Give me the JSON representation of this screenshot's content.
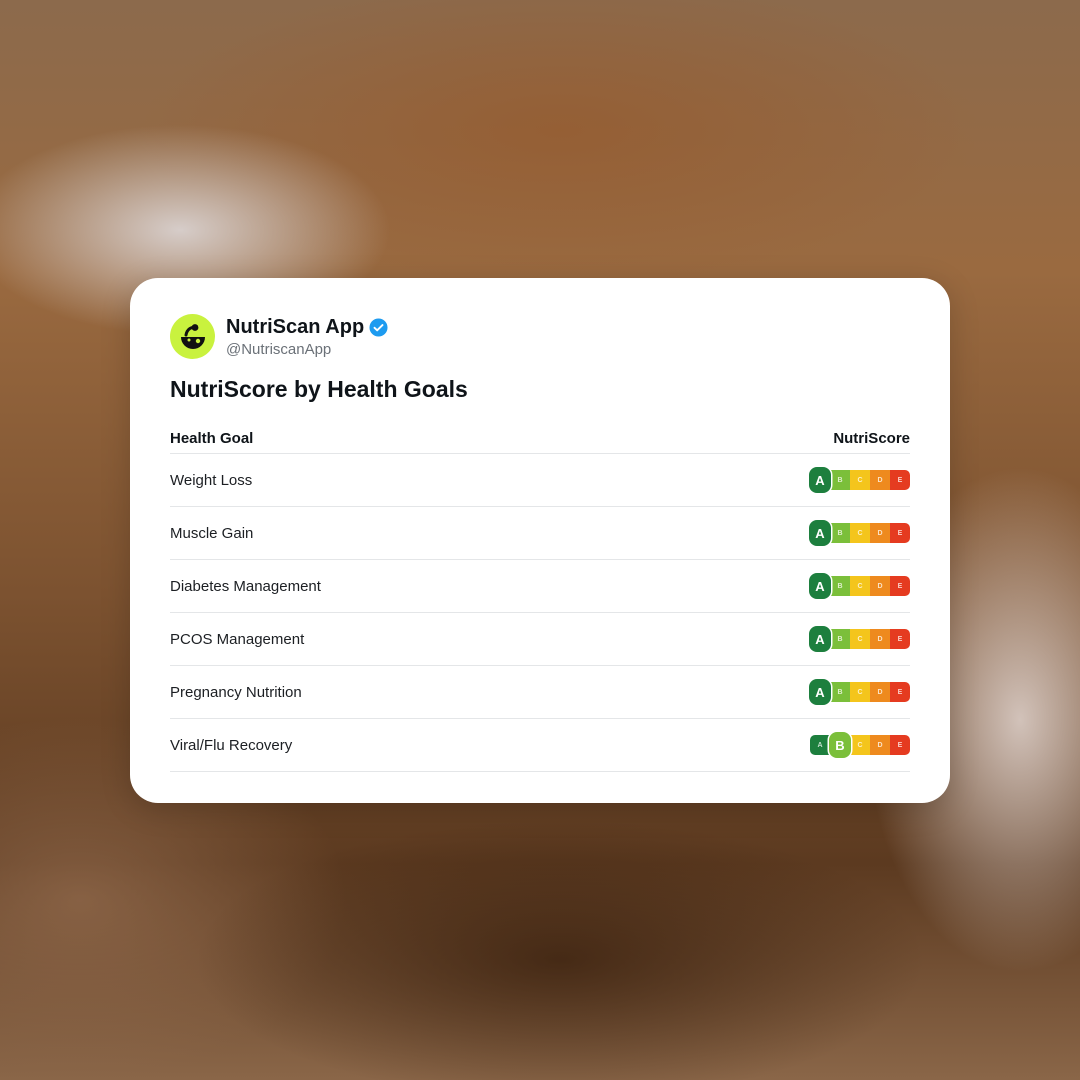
{
  "post": {
    "account_name": "NutriScan App",
    "handle": "@NutriscanApp",
    "verified": true,
    "title": "NutriScore by Health Goals",
    "avatar_icon": "nutriscan-logo-icon",
    "avatar_color": "#c9f23e",
    "verified_color": "#1d9bf0"
  },
  "table": {
    "headers": {
      "goal": "Health Goal",
      "score": "NutriScore"
    },
    "grades": [
      "A",
      "B",
      "C",
      "D",
      "E"
    ],
    "grade_colors": {
      "A": "#1d7f3e",
      "B": "#7bbf3a",
      "C": "#f4c51c",
      "D": "#ee8a1e",
      "E": "#e53b20"
    },
    "rows": [
      {
        "goal": "Weight Loss",
        "score": "A"
      },
      {
        "goal": "Muscle Gain",
        "score": "A"
      },
      {
        "goal": "Diabetes Management",
        "score": "A"
      },
      {
        "goal": "PCOS Management",
        "score": "A"
      },
      {
        "goal": "Pregnancy Nutrition",
        "score": "A"
      },
      {
        "goal": "Viral/Flu Recovery",
        "score": "B"
      }
    ]
  }
}
